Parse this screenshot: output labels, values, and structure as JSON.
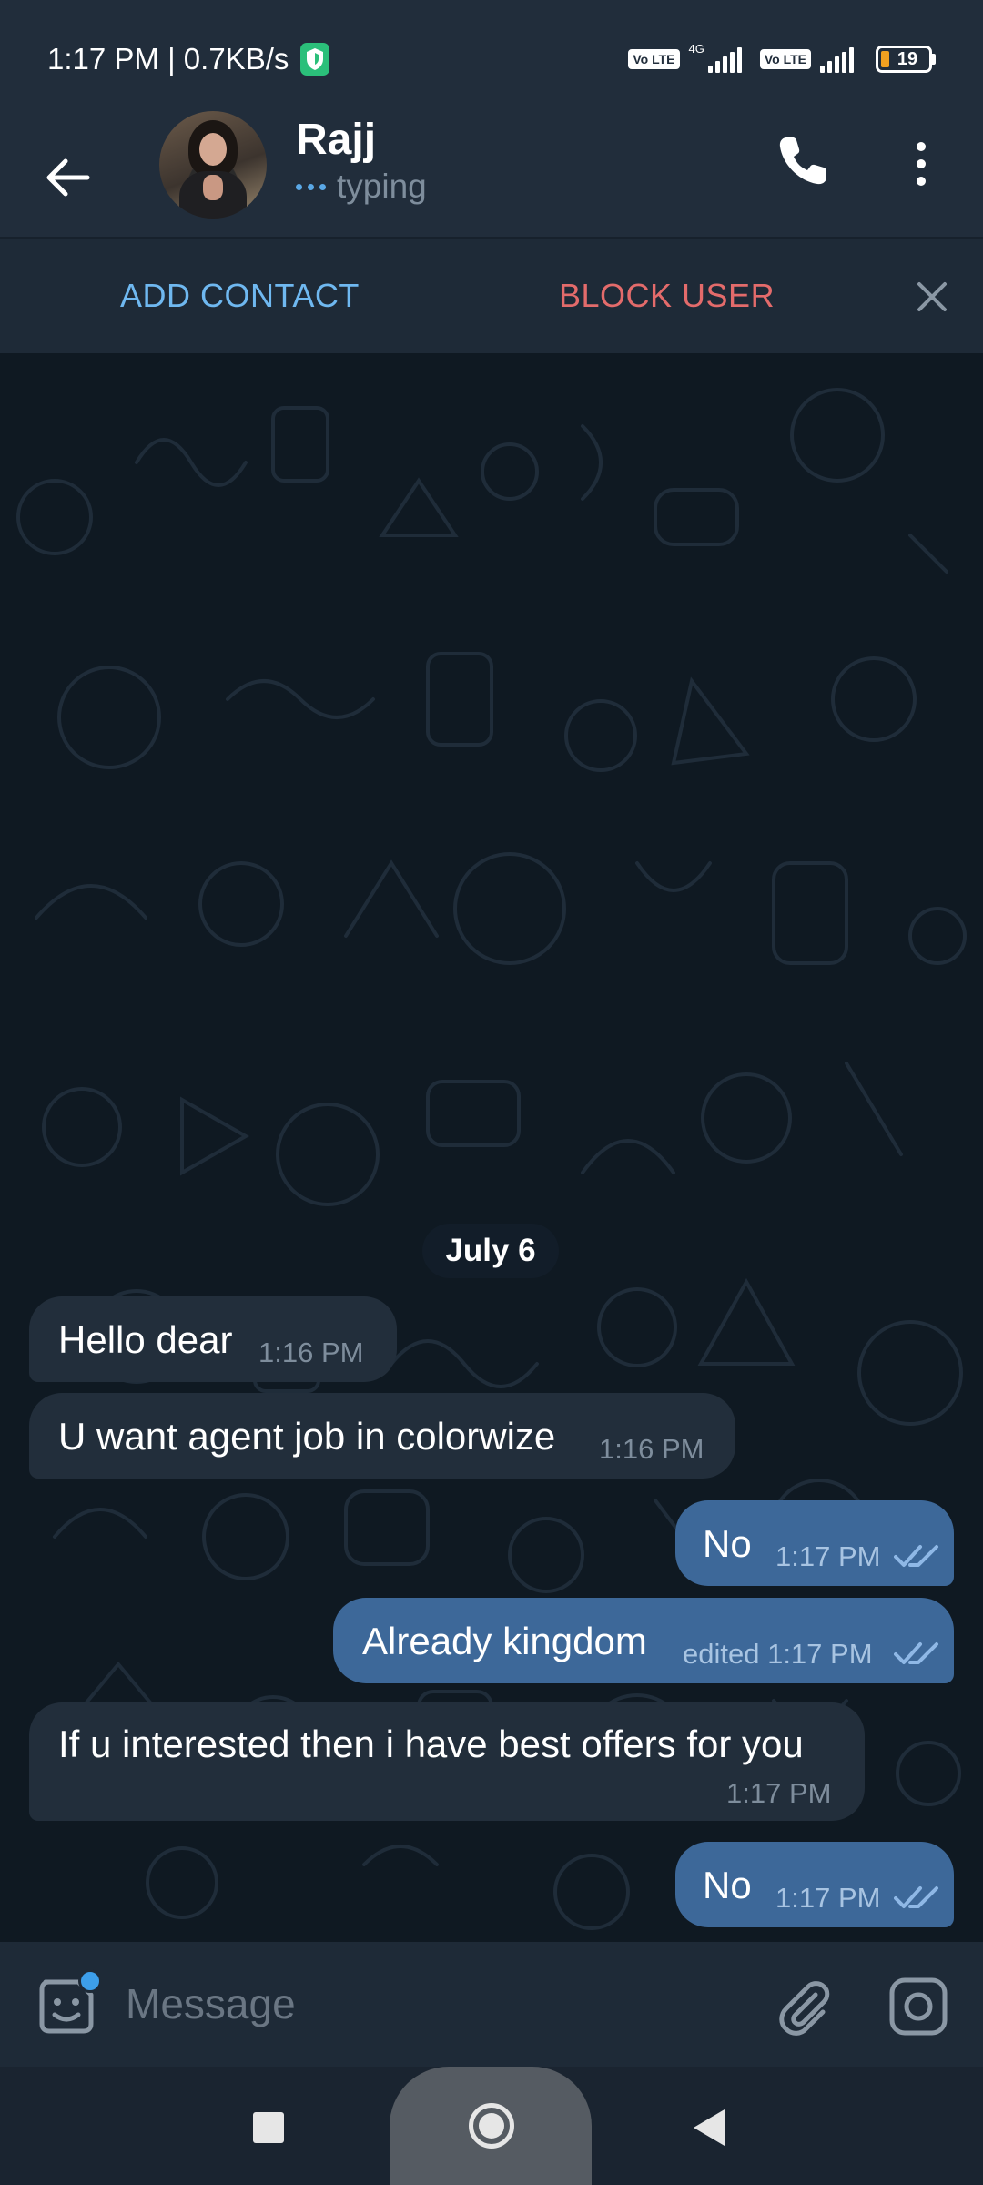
{
  "status_bar": {
    "time_speed": "1:17 PM | 0.7KB/s",
    "volte_1": "Vo LTE",
    "network_type": "4G",
    "volte_2": "Vo LTE",
    "battery_level": "19"
  },
  "header": {
    "contact_name": "Rajj",
    "status": "typing"
  },
  "action_bar": {
    "add_contact": "ADD CONTACT",
    "block_user": "BLOCK USER"
  },
  "chat": {
    "date_separator": "July 6",
    "messages": [
      {
        "direction": "in",
        "text": "Hello dear",
        "time": "1:16 PM"
      },
      {
        "direction": "in",
        "text": "U want agent job in colorwize",
        "time": "1:16 PM"
      },
      {
        "direction": "out",
        "text": "No",
        "time": "1:17 PM",
        "read": true
      },
      {
        "direction": "out",
        "text": "Already kingdom",
        "time": "edited 1:17 PM",
        "read": true
      },
      {
        "direction": "in",
        "text": "If u interested then i have best offers for you",
        "time": "1:17 PM"
      },
      {
        "direction": "out",
        "text": "No",
        "time": "1:17 PM",
        "read": true
      }
    ]
  },
  "composer": {
    "placeholder": "Message"
  },
  "colors": {
    "accent_blue": "#6fb8f0",
    "block_red": "#e36b6b",
    "outgoing_bubble": "#3d6899",
    "incoming_bubble": "#222e3b"
  },
  "icons": {
    "back": "arrow-left-icon",
    "call": "phone-icon",
    "menu": "more-vertical-icon",
    "close": "close-icon",
    "emoji": "sticker-emoji-icon",
    "attach": "paperclip-icon",
    "camera": "camera-icon",
    "shield": "vpn-shield-icon"
  }
}
